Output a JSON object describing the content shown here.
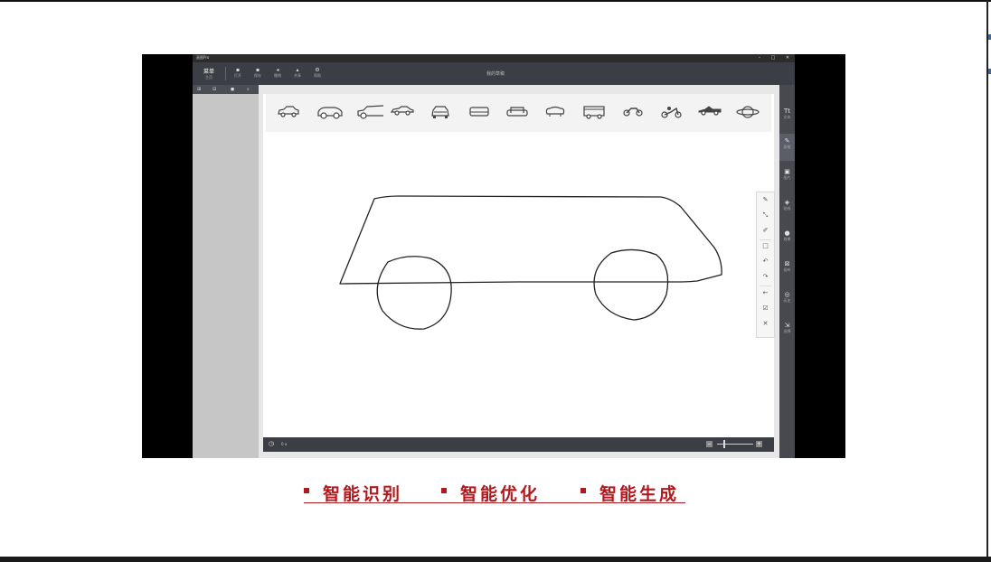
{
  "window": {
    "app_name": "画图Pro",
    "minimize_label": "–",
    "maximize_label": "□",
    "close_label": "✕"
  },
  "ribbon": {
    "home_label": "菜单",
    "home_sub": "主页",
    "buttons": [
      {
        "icon": "▪",
        "label": "打开"
      },
      {
        "icon": "▪",
        "label": "保存"
      },
      {
        "icon": "◂",
        "label": "撤销"
      },
      {
        "icon": "▴",
        "label": "共享"
      },
      {
        "icon": "⚙",
        "label": "帮助"
      }
    ],
    "doc_title": "我的草稿"
  },
  "left_panel": {
    "tabs": [
      "⊞",
      "⊟",
      "◼",
      "⌕"
    ]
  },
  "right_strip": {
    "items": [
      {
        "icon": "Tt",
        "label": "文本"
      },
      {
        "icon": "✎",
        "label": "画笔"
      },
      {
        "icon": "▣",
        "label": "图片"
      },
      {
        "icon": "◈",
        "label": "贴纸"
      },
      {
        "icon": "●",
        "label": "效果"
      },
      {
        "icon": "⊠",
        "label": "画布"
      },
      {
        "icon": "◎",
        "label": "历史"
      },
      {
        "icon": "⇲",
        "label": "选择"
      }
    ],
    "active_index": 1
  },
  "suggestions": [
    "sedan",
    "hatchback",
    "pickup",
    "sports-car",
    "suv-front",
    "sofa",
    "armchair",
    "loveseat",
    "fire-truck",
    "motorcycle",
    "scooter",
    "racing-car",
    "planet"
  ],
  "tools": [
    {
      "icon": "✎",
      "name": "pen"
    },
    {
      "icon": "⤡",
      "name": "brush"
    },
    {
      "icon": "✐",
      "name": "marker"
    },
    {
      "icon": "□",
      "name": "shape"
    },
    {
      "icon": "↶",
      "name": "undo"
    },
    {
      "icon": "↷",
      "name": "redo"
    },
    {
      "icon": "←",
      "name": "back"
    },
    {
      "icon": "☑",
      "name": "accept"
    },
    {
      "icon": "✕",
      "name": "close"
    }
  ],
  "status_bar": {
    "clock_icon": "◷",
    "stat_text": "0 a",
    "zoom_minus": "−",
    "zoom_plus": "+"
  },
  "features": [
    {
      "label": "智能识别"
    },
    {
      "label": "智能优化"
    },
    {
      "label": "智能生成"
    }
  ],
  "colors": {
    "accent_red": "#b0191e",
    "ribbon": "#3b3e44",
    "canvas": "#ffffff"
  }
}
